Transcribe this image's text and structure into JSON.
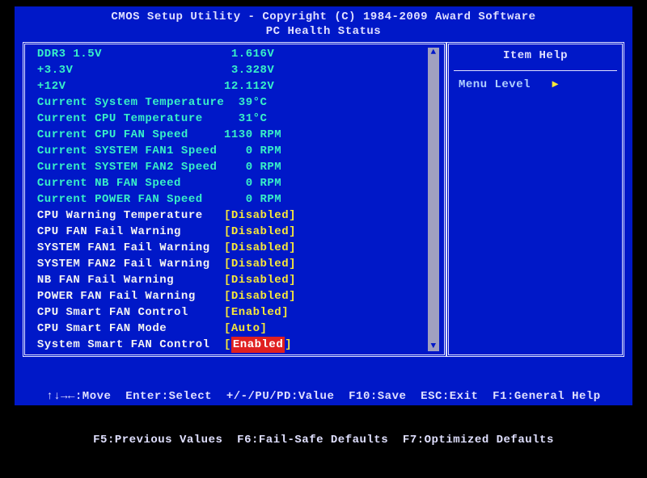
{
  "header": {
    "title": "CMOS Setup Utility - Copyright (C) 1984-2009 Award Software",
    "subtitle": "PC Health Status"
  },
  "readings": [
    {
      "label": "DDR3 1.5V",
      "value": " 1.616V"
    },
    {
      "label": "+3.3V",
      "value": " 3.328V"
    },
    {
      "label": "+12V",
      "value": "12.112V"
    },
    {
      "label": "Current System Temperature",
      "value": "  39°C"
    },
    {
      "label": "Current CPU Temperature",
      "value": "  31°C"
    },
    {
      "label": "Current CPU FAN Speed",
      "value": "1130 RPM"
    },
    {
      "label": "Current SYSTEM FAN1 Speed",
      "value": "   0 RPM"
    },
    {
      "label": "Current SYSTEM FAN2 Speed",
      "value": "   0 RPM"
    },
    {
      "label": "Current NB FAN Speed",
      "value": "   0 RPM"
    },
    {
      "label": "Current POWER FAN Speed",
      "value": "   0 RPM"
    }
  ],
  "settings": [
    {
      "label": "CPU Warning Temperature",
      "value": "[Disabled]",
      "selected": false
    },
    {
      "label": "CPU FAN Fail Warning",
      "value": "[Disabled]",
      "selected": false
    },
    {
      "label": "SYSTEM FAN1 Fail Warning",
      "value": "[Disabled]",
      "selected": false
    },
    {
      "label": "SYSTEM FAN2 Fail Warning",
      "value": "[Disabled]",
      "selected": false
    },
    {
      "label": "NB FAN Fail Warning",
      "value": "[Disabled]",
      "selected": false
    },
    {
      "label": "POWER FAN Fail Warning",
      "value": "[Disabled]",
      "selected": false
    },
    {
      "label": "CPU Smart FAN Control",
      "value": "[Enabled]",
      "selected": false
    },
    {
      "label": "CPU Smart FAN Mode",
      "value": "[Auto]",
      "selected": false
    },
    {
      "label": "System Smart FAN Control",
      "value": "[",
      "inner": "Enabled",
      "close": "]",
      "selected": true
    }
  ],
  "help": {
    "title": "Item Help",
    "menu_level": "Menu Level",
    "arrow": "▸"
  },
  "scroll": {
    "up": "▲",
    "down": "▼"
  },
  "footer": {
    "line1": "↑↓→←:Move  Enter:Select  +/-/PU/PD:Value  F10:Save  ESC:Exit  F1:General Help",
    "line2": "F5:Previous Values  F6:Fail-Safe Defaults  F7:Optimized Defaults"
  }
}
